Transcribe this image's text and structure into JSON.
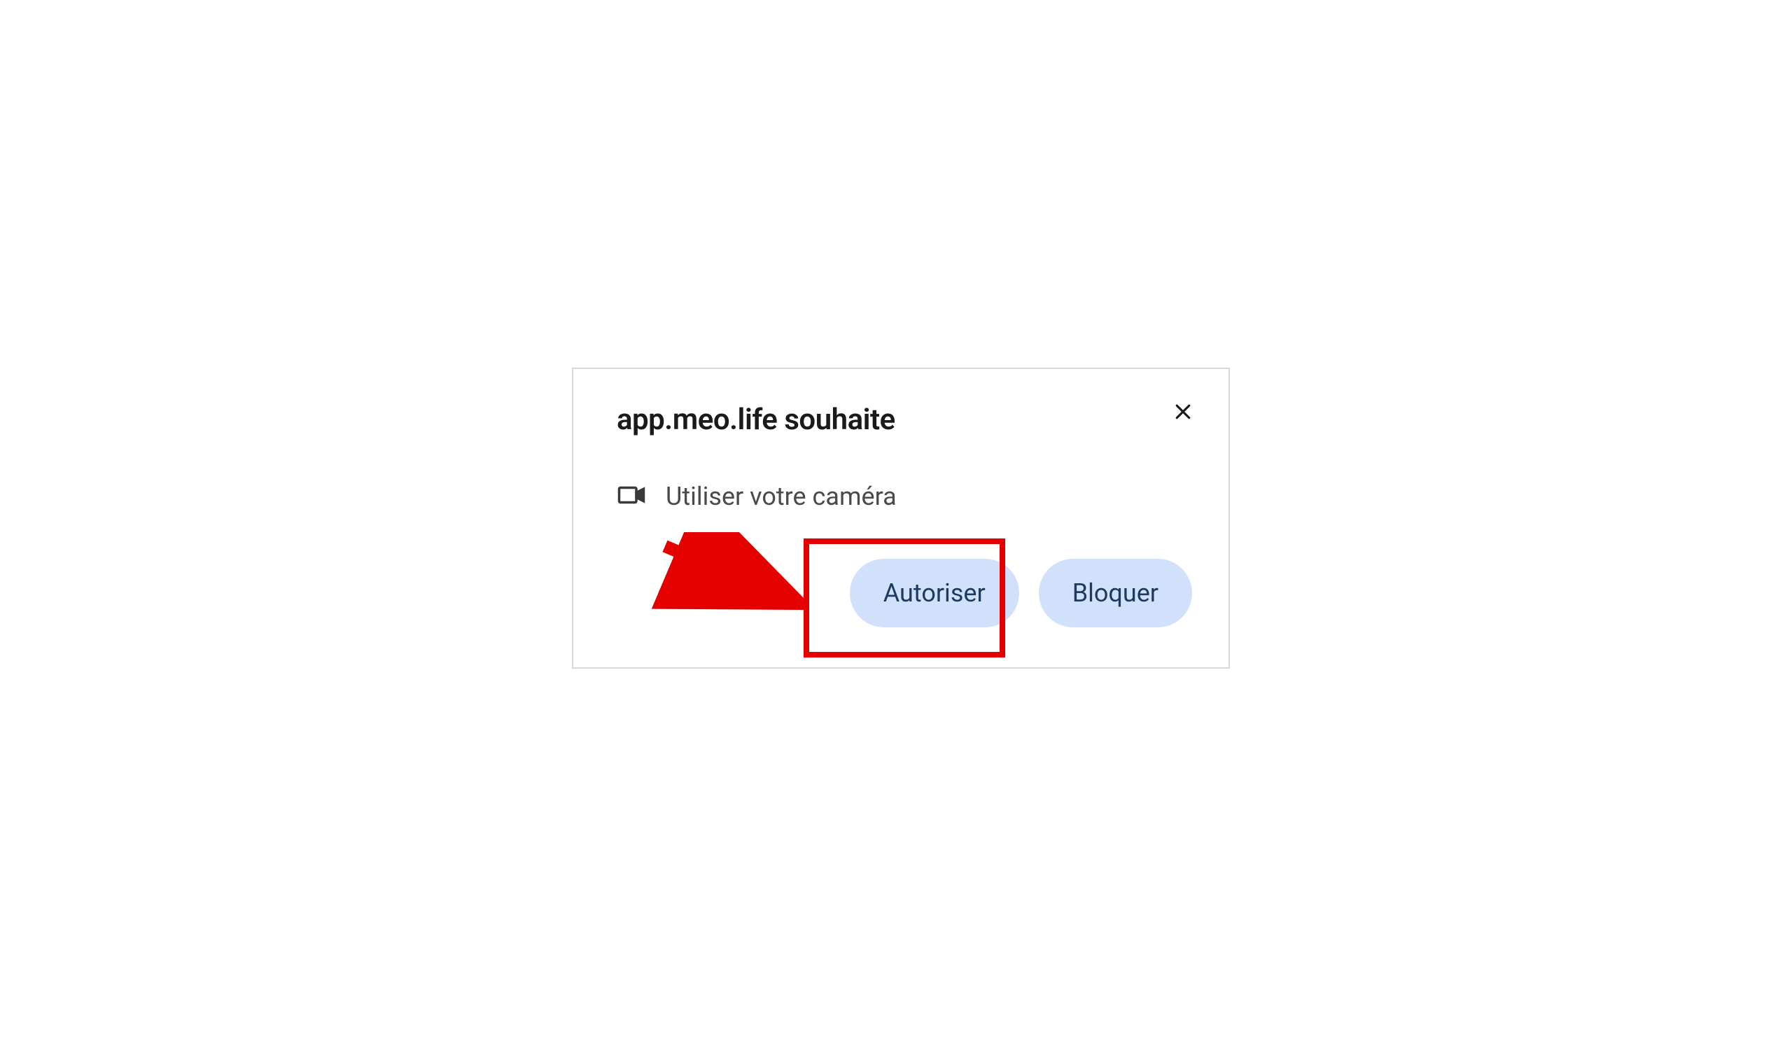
{
  "dialog": {
    "title": "app.meo.life souhaite",
    "permission_text": "Utiliser votre caméra",
    "allow_label": "Autoriser",
    "block_label": "Bloquer"
  }
}
